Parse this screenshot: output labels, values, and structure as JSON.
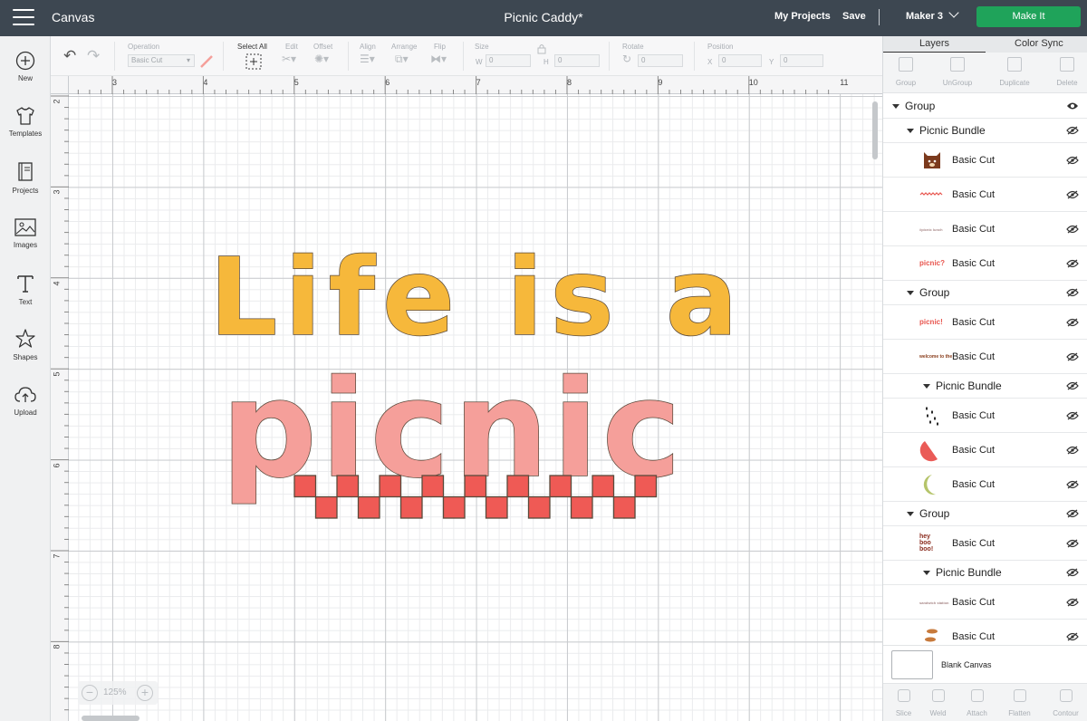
{
  "topbar": {
    "app_title": "Canvas",
    "doc_title": "Picnic Caddy*",
    "my_projects": "My Projects",
    "save": "Save",
    "separator": "|",
    "machine": "Maker 3",
    "make_it": "Make It"
  },
  "sidebar": {
    "items": [
      {
        "label": "New",
        "icon": "plus-circle-icon"
      },
      {
        "label": "Templates",
        "icon": "tshirt-icon"
      },
      {
        "label": "Projects",
        "icon": "book-icon"
      },
      {
        "label": "Images",
        "icon": "image-icon"
      },
      {
        "label": "Text",
        "icon": "text-icon"
      },
      {
        "label": "Shapes",
        "icon": "shapes-icon"
      },
      {
        "label": "Upload",
        "icon": "upload-cloud-icon"
      }
    ]
  },
  "toolbar": {
    "operation_label": "Operation",
    "operation_value": "Basic Cut",
    "select_all": "Select All",
    "edit": "Edit",
    "offset": "Offset",
    "align": "Align",
    "arrange": "Arrange",
    "flip": "Flip",
    "size": "Size",
    "w": "W",
    "w_value": "0",
    "h": "H",
    "h_value": "0",
    "rotate": "Rotate",
    "rotate_value": "0",
    "position": "Position",
    "x": "X",
    "x_value": "0",
    "y": "Y",
    "y_value": "0"
  },
  "ruler": {
    "top": [
      "3",
      "4",
      "5",
      "6",
      "7",
      "8",
      "9",
      "10",
      "11"
    ],
    "left": [
      "2",
      "3",
      "4",
      "5",
      "6",
      "7",
      "8"
    ]
  },
  "zoom": {
    "value": "125%",
    "minus": "−",
    "plus": "+"
  },
  "design": {
    "line1": "Life is a",
    "line2": "picnic"
  },
  "panel": {
    "tab_layers": "Layers",
    "tab_color_sync": "Color Sync",
    "actions": [
      "Group",
      "UnGroup",
      "Duplicate",
      "Delete"
    ],
    "layers": [
      {
        "kind": "group",
        "level": 0,
        "name": "Group",
        "visible": true
      },
      {
        "kind": "group",
        "level": 1,
        "name": "Picnic Bundle"
      },
      {
        "kind": "item",
        "name": "Basic Cut",
        "thumb": "bear",
        "h": 38
      },
      {
        "kind": "item",
        "name": "Basic Cut",
        "thumb": "zigzag",
        "h": 38
      },
      {
        "kind": "item",
        "name": "Basic Cut",
        "thumb": "text-small",
        "thumb_text": "#picnic lunch",
        "h": 38
      },
      {
        "kind": "item",
        "name": "Basic Cut",
        "thumb": "text-red",
        "thumb_text": "picnic?",
        "h": 38
      },
      {
        "kind": "group",
        "level": 1,
        "name": "Group"
      },
      {
        "kind": "item",
        "name": "Basic Cut",
        "thumb": "text-red",
        "thumb_text": "picnic!",
        "h": 38
      },
      {
        "kind": "item",
        "name": "Basic Cut",
        "thumb": "text-brown",
        "thumb_text": "welcome to the",
        "h": 38
      },
      {
        "kind": "group",
        "level": 2,
        "name": "Picnic Bundle"
      },
      {
        "kind": "item",
        "name": "Basic Cut",
        "thumb": "seeds",
        "h": 38
      },
      {
        "kind": "item",
        "name": "Basic Cut",
        "thumb": "watermelon",
        "h": 38
      },
      {
        "kind": "item",
        "name": "Basic Cut",
        "thumb": "rind",
        "h": 38
      },
      {
        "kind": "group",
        "level": 1,
        "name": "Group"
      },
      {
        "kind": "item",
        "name": "Basic Cut",
        "thumb": "text-hey",
        "thumb_text": "hey boo boo!",
        "h": 38
      },
      {
        "kind": "group",
        "level": 2,
        "name": "Picnic Bundle"
      },
      {
        "kind": "item",
        "name": "Basic Cut",
        "thumb": "text-small",
        "thumb_text": "sandwich station",
        "h": 38
      },
      {
        "kind": "item",
        "name": "Basic Cut",
        "thumb": "almonds",
        "h": 38
      }
    ],
    "blank_canvas": "Blank Canvas",
    "bottom_actions": [
      "Slice",
      "Weld",
      "Attach",
      "Flatten",
      "Contour"
    ]
  }
}
